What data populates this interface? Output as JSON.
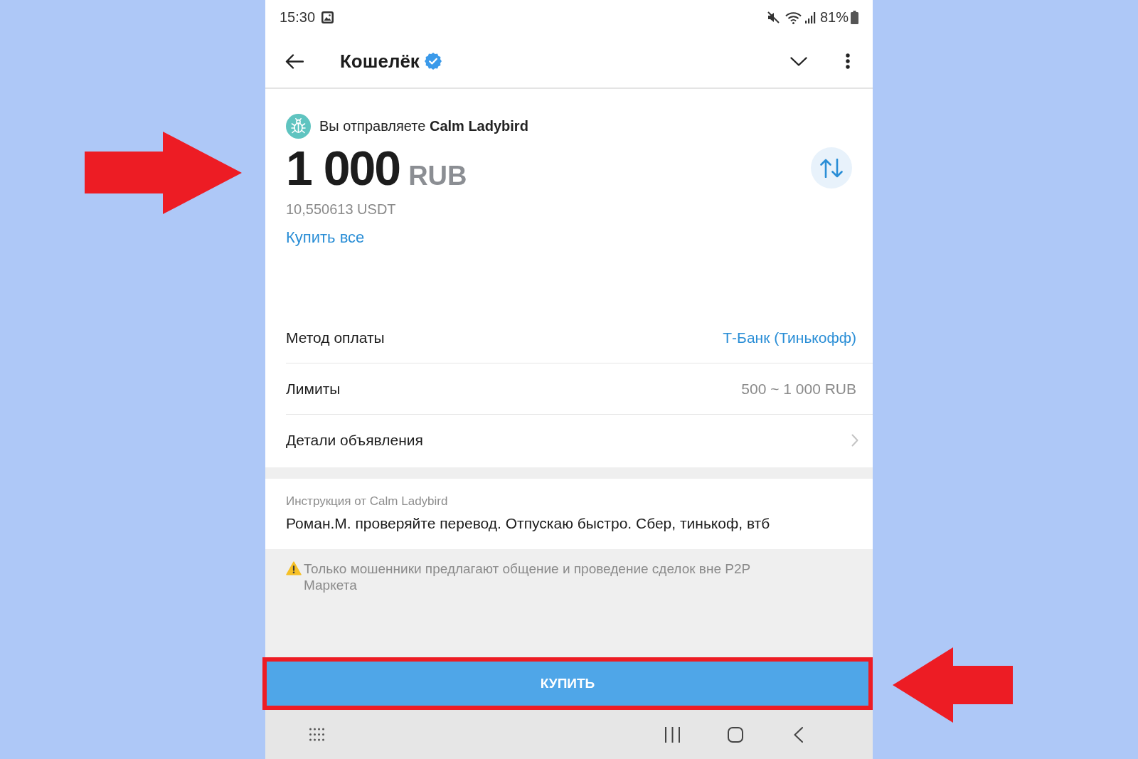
{
  "status_bar": {
    "time": "15:30",
    "battery": "81%"
  },
  "header": {
    "title": "Кошелёк",
    "verified": true
  },
  "offer": {
    "sender": "Вы отправляете **Calm Ladybird**",
    "amount": "1 000",
    "currency": "RUB",
    "highlighted": true,
    "converted": "10,550613 USDT",
    "buy_all_link": "Купить все"
  },
  "details": [
    {
      "kind": "link",
      "label": "Метод оплаты",
      "value": "Т-Банк (Тинькофф)"
    },
    {
      "kind": "text",
      "label": "Лимиты",
      "value": "500 ~ 1 000 RUB"
    },
    {
      "kind": "nav",
      "label": "Детали объявления"
    }
  ],
  "instruction": {
    "label": "Инструкция от Calm Ladybird",
    "text": "Роман.М. проверяйте перевод. Отпускаю быстро. Сбер, тинькоф, втб"
  },
  "warning": "Только мошенники предлагают общение и проведение сделок вне P2P Маркета",
  "buy_button": {
    "label": "КУПИТЬ",
    "highlighted": true
  }
}
